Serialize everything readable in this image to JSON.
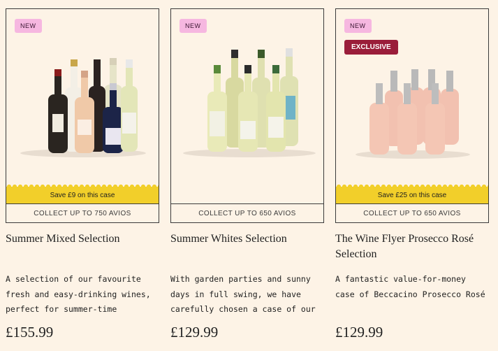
{
  "products": [
    {
      "badge": "NEW",
      "save": "Save £9 on this case",
      "avios": "COLLECT UP TO 750 AVIOS",
      "title": "Summer Mixed Selection",
      "desc": "A selection of our favourite fresh and easy-drinking wines, perfect for summer-time drinking",
      "price": "£155.99"
    },
    {
      "badge": "NEW",
      "avios": "COLLECT UP TO 650 AVIOS",
      "title": "Summer Whites Selection",
      "desc": "With garden parties and sunny days in full swing, we have carefully chosen a case of our favourite whit…",
      "price": "£129.99"
    },
    {
      "badge": "NEW",
      "exclusive": "EXCLUSIVE",
      "save": "Save £25 on this case",
      "avios": "COLLECT UP TO 650 AVIOS",
      "title": "The Wine Flyer Prosecco Rosé Selection",
      "desc": "A fantastic value-for-money case of Beccacino Prosecco Rosé",
      "price": "£129.99"
    }
  ]
}
